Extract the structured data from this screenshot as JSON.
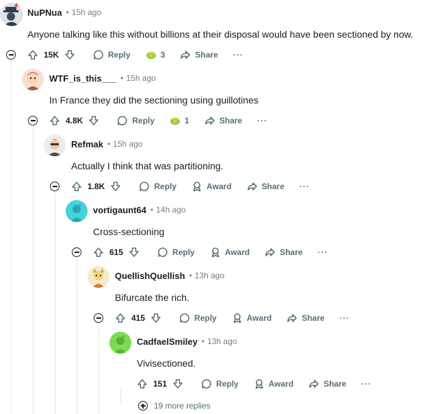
{
  "comments": [
    {
      "author": "NuPNua",
      "time": "15h ago",
      "text": "Anyone talking like this without billions at their disposal would have been sectioned by now.",
      "score": "15K",
      "reply_label": "Reply",
      "award_count": "3",
      "share_label": "Share",
      "avatar_color": "#3a4b5c"
    },
    {
      "author": "WTF_is_this___",
      "time": "15h ago",
      "text": "In France they did the sectioning using guillotines",
      "score": "4.8K",
      "reply_label": "Reply",
      "award_count": "1",
      "share_label": "Share",
      "avatar_color": "#e8c4a0"
    },
    {
      "author": "Refmak",
      "time": "15h ago",
      "text": "Actually I think that was partitioning.",
      "score": "1.8K",
      "reply_label": "Reply",
      "award_label": "Award",
      "share_label": "Share",
      "avatar_color": "#d9d9d9"
    },
    {
      "author": "vortigaunt64",
      "time": "14h ago",
      "text": "Cross-sectioning",
      "score": "615",
      "reply_label": "Reply",
      "award_label": "Award",
      "share_label": "Share",
      "avatar_color": "#46d1dc"
    },
    {
      "author": "QuellishQuellish",
      "time": "13h ago",
      "text": "Bifurcate the rich.",
      "score": "415",
      "reply_label": "Reply",
      "award_label": "Award",
      "share_label": "Share",
      "avatar_color": "#f2d37a"
    },
    {
      "author": "CadfaelSmiley",
      "time": "13h ago",
      "text": "Vivisectioned.",
      "score": "151",
      "reply_label": "Reply",
      "award_label": "Award",
      "share_label": "Share",
      "avatar_color": "#7ed957"
    }
  ],
  "more_replies": "19 more replies",
  "more_glyph": "···",
  "dot_glyph": "•"
}
